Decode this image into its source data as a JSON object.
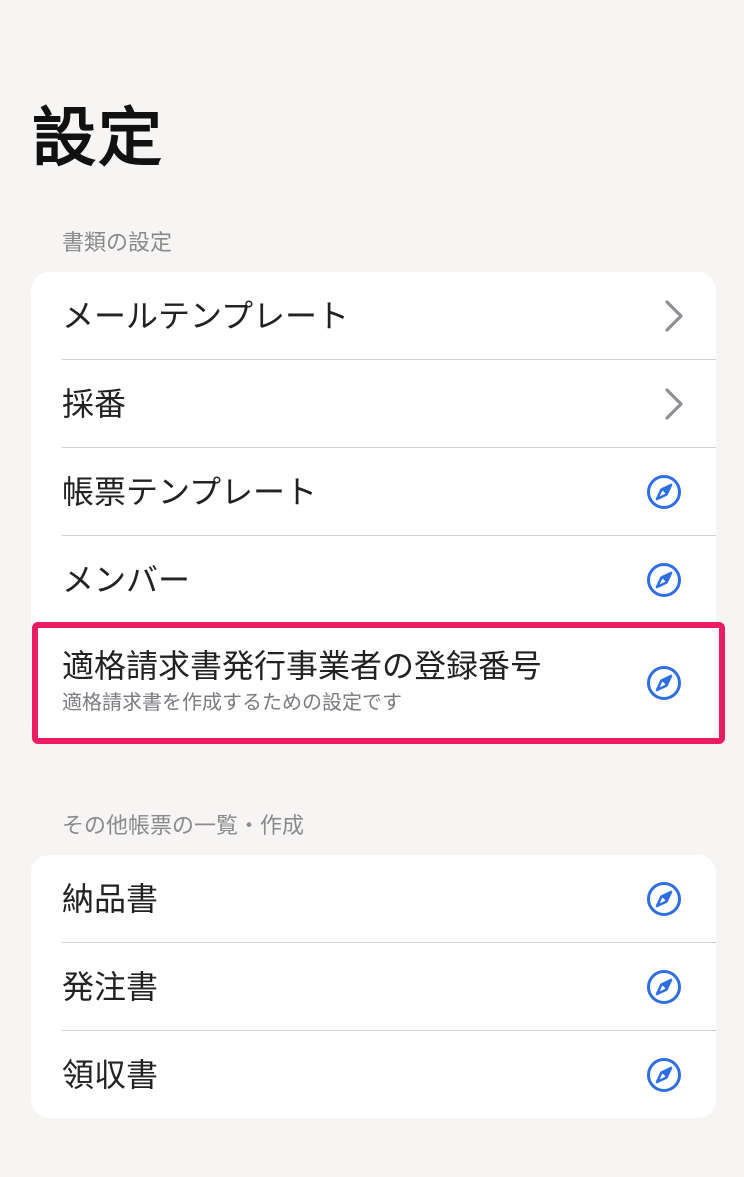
{
  "title": "設定",
  "sections": [
    {
      "header": "書類の設定",
      "items": [
        {
          "label": "メールテンプレート",
          "icon": "chevron-right-icon"
        },
        {
          "label": "採番",
          "icon": "chevron-right-icon"
        },
        {
          "label": "帳票テンプレート",
          "icon": "safari-compass-icon"
        },
        {
          "label": "メンバー",
          "icon": "safari-compass-icon"
        },
        {
          "label": "適格請求書発行事業者の登録番号",
          "subtitle": "適格請求書を作成するための設定です",
          "icon": "safari-compass-icon",
          "highlighted": true
        }
      ]
    },
    {
      "header": "その他帳票の一覧・作成",
      "items": [
        {
          "label": "納品書",
          "icon": "safari-compass-icon"
        },
        {
          "label": "発注書",
          "icon": "safari-compass-icon"
        },
        {
          "label": "領収書",
          "icon": "safari-compass-icon"
        }
      ]
    }
  ],
  "colors": {
    "background": "#f6f5f3",
    "card": "#ffffff",
    "accent_link": "#2f6fe4",
    "chevron": "#8e8e93",
    "highlight_border": "#ea1d63"
  }
}
